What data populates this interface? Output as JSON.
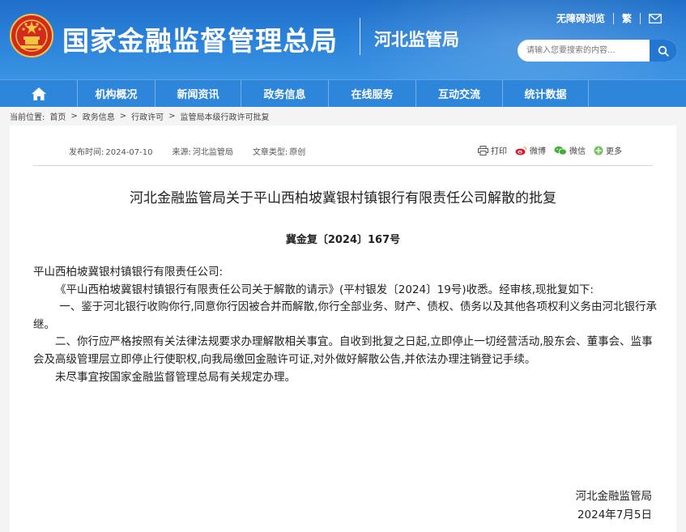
{
  "header": {
    "site_title": "国家金融监督管理总局",
    "sub_title": "河北监管局",
    "top_links": [
      "无障碍浏览",
      "繁"
    ],
    "search_placeholder": "请输入您要搜索的内容...",
    "colors": {
      "header_blue": "#2c84db",
      "nav_blue": "#2e86db",
      "emblem_red": "#d22a1e",
      "emblem_gold": "#f5c542"
    }
  },
  "nav": {
    "items": [
      "机构概况",
      "新闻资讯",
      "政务信息",
      "在线服务",
      "互动交流",
      "统计数据"
    ]
  },
  "breadcrumb": {
    "label": "当前位置:",
    "items": [
      "首页",
      "政务信息",
      "行政许可",
      "监管局本级行政许可批复"
    ],
    "separator": ">"
  },
  "meta": {
    "publish_label": "发布时间:",
    "publish_value": "2024-07-10",
    "source_label": "来源:",
    "source_value": "河北监管局",
    "type_label": "文章类型:",
    "type_value": "原创"
  },
  "share": {
    "items": [
      {
        "label": "打印",
        "icon": "print-icon"
      },
      {
        "label": "微博",
        "icon": "weibo-icon"
      },
      {
        "label": "微信",
        "icon": "wechat-icon"
      },
      {
        "label": "更多",
        "icon": "more-icon"
      }
    ]
  },
  "article": {
    "title": "河北金融监管局关于平山西柏坡冀银村镇银行有限责任公司解散的批复",
    "doc_number": "冀金复〔2024〕167号",
    "paragraphs": [
      "平山西柏坡冀银村镇银行有限责任公司:",
      "《平山西柏坡冀银村镇银行有限责任公司关于解散的请示》(平村银发〔2024〕19号)收悉。经审核,现批复如下:",
      "一、鉴于河北银行收购你行,同意你行因被合并而解散,你行全部业务、财产、债权、债务以及其他各项权利义务由河北银行承继。",
      "二、你行应严格按照有关法律法规要求办理解散相关事宜。自收到批复之日起,立即停止一切经营活动,股东会、董事会、监事会及高级管理层立即停止行使职权,向我局缴回金融许可证,对外做好解散公告,并依法办理注销登记手续。",
      "未尽事宜按国家金融监督管理总局有关规定办理。"
    ],
    "signature_org": "河北金融监管局",
    "signature_date": "2024年7月5日"
  }
}
